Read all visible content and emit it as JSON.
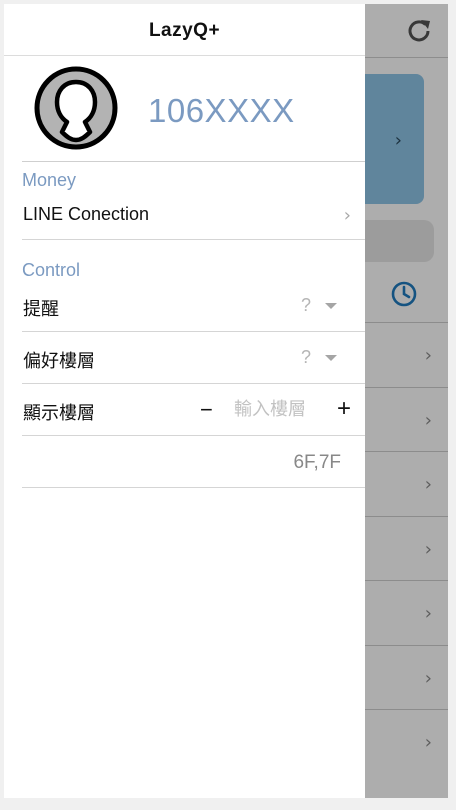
{
  "app": {
    "title": "LazyQ+"
  },
  "profile": {
    "user_id": "106XXXX"
  },
  "sections": {
    "money": {
      "label": "Money",
      "line_connection": "LINE Conection"
    },
    "control": {
      "label": "Control",
      "reminder": {
        "label": "提醒",
        "value": "?"
      },
      "preferred_floor": {
        "label": "偏好樓層",
        "value": "?"
      },
      "display_floor": {
        "label": "顯示樓層",
        "minus": "−",
        "plus": "+",
        "input_placeholder": "輸入樓層",
        "floors": "6F,7F"
      }
    }
  },
  "background": {
    "card_chevron": "›",
    "row_chevron": "›",
    "row_count": 7
  },
  "colors": {
    "accent": "#7b9ac1",
    "clock": "#1f7bbf",
    "card": "#8ec4e6",
    "overlay": "rgba(0,0,0,0.32)"
  },
  "icons": {
    "refresh": "refresh-icon",
    "clock": "clock-icon",
    "avatar": "user-avatar-icon",
    "chevron": "chevron-right-icon",
    "caret": "caret-down-icon"
  }
}
